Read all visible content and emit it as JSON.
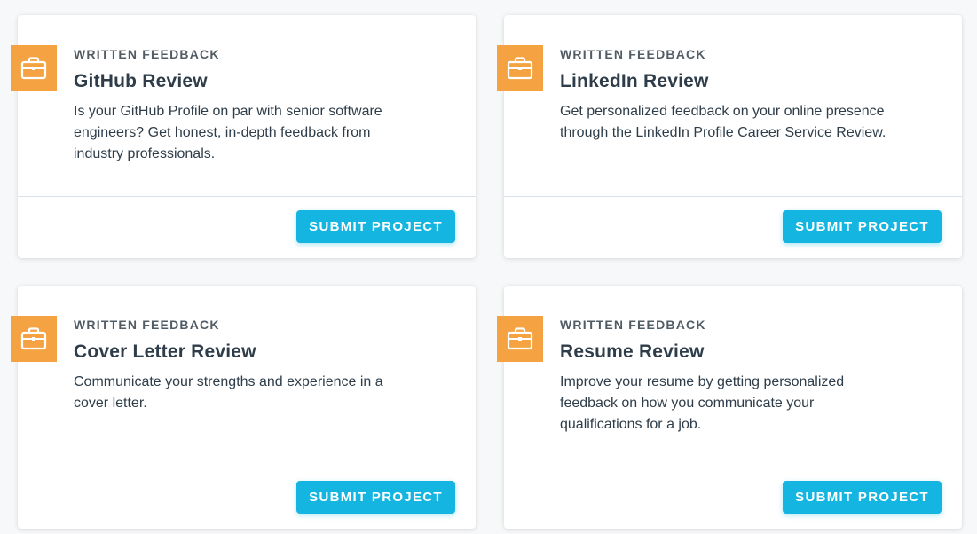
{
  "cards": [
    {
      "category": "Written Feedback",
      "title": "GitHub Review",
      "description": "Is your GitHub Profile on par with senior software engineers? Get honest, in-depth feedback from industry professionals.",
      "button_label": "Submit Project",
      "icon": "briefcase-icon"
    },
    {
      "category": "Written Feedback",
      "title": "LinkedIn Review",
      "description": "Get personalized feedback on your online presence through the LinkedIn Profile Career Service Review.",
      "button_label": "Submit Project",
      "icon": "briefcase-icon"
    },
    {
      "category": "Written Feedback",
      "title": "Cover Letter Review",
      "description": "Communicate your strengths and experience in a cover letter.",
      "button_label": "Submit Project",
      "icon": "briefcase-icon"
    },
    {
      "category": "Written Feedback",
      "title": "Resume Review",
      "description": "Improve your resume by getting personalized feedback on how you communicate your qualifications for a job.",
      "button_label": "Submit Project",
      "icon": "briefcase-icon"
    }
  ],
  "colors": {
    "badge": "#f5a242",
    "button": "#14b5e1",
    "text": "#2e3d49"
  }
}
